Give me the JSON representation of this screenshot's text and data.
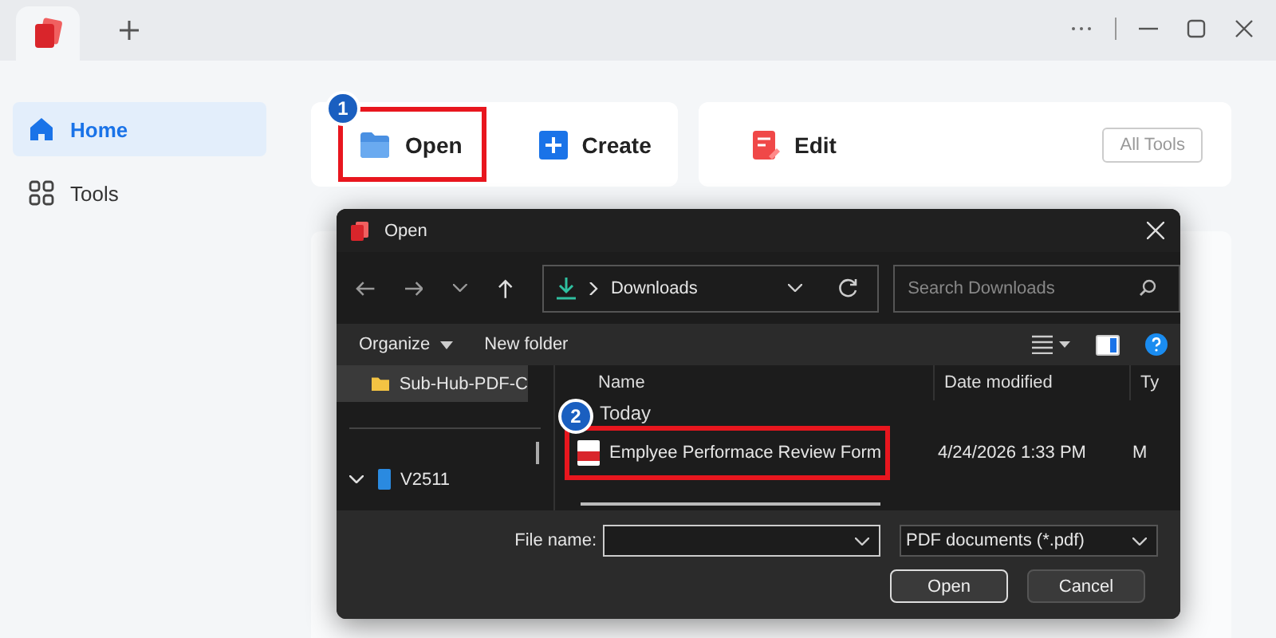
{
  "sidebar": {
    "items": [
      {
        "label": "Home",
        "kind": "home",
        "selected": true
      },
      {
        "label": "Tools",
        "kind": "tools",
        "selected": false
      }
    ]
  },
  "cards": [
    {
      "actions": [
        {
          "label": "Open",
          "kind": "open",
          "highlighted": true,
          "step": "1"
        },
        {
          "label": "Create",
          "kind": "create",
          "highlighted": false
        }
      ]
    },
    {
      "actions": [
        {
          "label": "Edit",
          "kind": "edit",
          "highlighted": false
        }
      ],
      "button": "All Tools"
    }
  ],
  "dialog": {
    "title": "Open",
    "location": "Downloads",
    "search": {
      "placeholder": "Search Downloads"
    },
    "toolbar": {
      "organize": "Organize",
      "new_folder": "New folder"
    },
    "nav_items": [
      {
        "label": "Sub-Hub-PDF-C",
        "kind": "folder",
        "selected": true
      },
      {
        "label": "V2511",
        "kind": "drive",
        "selected": false,
        "expanded": true
      }
    ],
    "columns": [
      "Name",
      "Date modified",
      "Ty"
    ],
    "groups": [
      {
        "label": "Today",
        "files": [
          {
            "name": "Emplyee Performace Review Form",
            "date": "4/24/2026 1:33 PM",
            "column_3": "M",
            "highlighted": true,
            "step": "2"
          }
        ]
      }
    ],
    "file_name_label": "File name:",
    "file_type": "PDF documents (*.pdf)",
    "buttons": [
      "Open",
      "Cancel"
    ]
  }
}
